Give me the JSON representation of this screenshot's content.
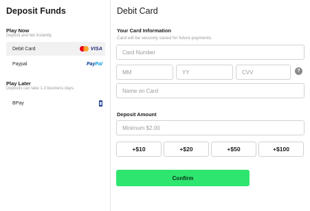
{
  "left_panel": {
    "title": "Deposit Funds",
    "play_now": {
      "title": "Play Now",
      "subtitle": "Deposit and bet instantly.",
      "methods": [
        {
          "label": "Debit Card",
          "logos": [
            "mastercard-logo",
            "visa-logo"
          ],
          "visa_text": "VISA",
          "selected": true
        },
        {
          "label": "Paypal",
          "logos": [
            "paypal-logo"
          ],
          "paypal_text_a": "Pay",
          "paypal_text_b": "Pal",
          "selected": false
        }
      ]
    },
    "play_later": {
      "title": "Play Later",
      "subtitle": "Deposits can take 1-3 business days.",
      "methods": [
        {
          "label": "BPay",
          "logos": [
            "bpay-logo"
          ],
          "selected": false
        }
      ]
    }
  },
  "main": {
    "title": "Debit Card",
    "card_info": {
      "title": "Your Card Information",
      "hint": "Card will be securely saved for future payments.",
      "card_number_placeholder": "Card Number",
      "mm_placeholder": "MM",
      "yy_placeholder": "YY",
      "cvv_placeholder": "CVV",
      "help_icon": "question-circle-icon",
      "help_glyph": "?",
      "name_placeholder": "Name on Card"
    },
    "deposit": {
      "title": "Deposit Amount",
      "amount_placeholder": "Minimum $2.00",
      "quick_amounts": [
        "+$10",
        "+$20",
        "+$50",
        "+$100"
      ]
    },
    "confirm_label": "Confirm"
  },
  "colors": {
    "accent_button": "#2ee66f",
    "selected_row": "#f1f1f1",
    "border": "#d2d2d2",
    "muted_text": "#9a9a9a"
  }
}
